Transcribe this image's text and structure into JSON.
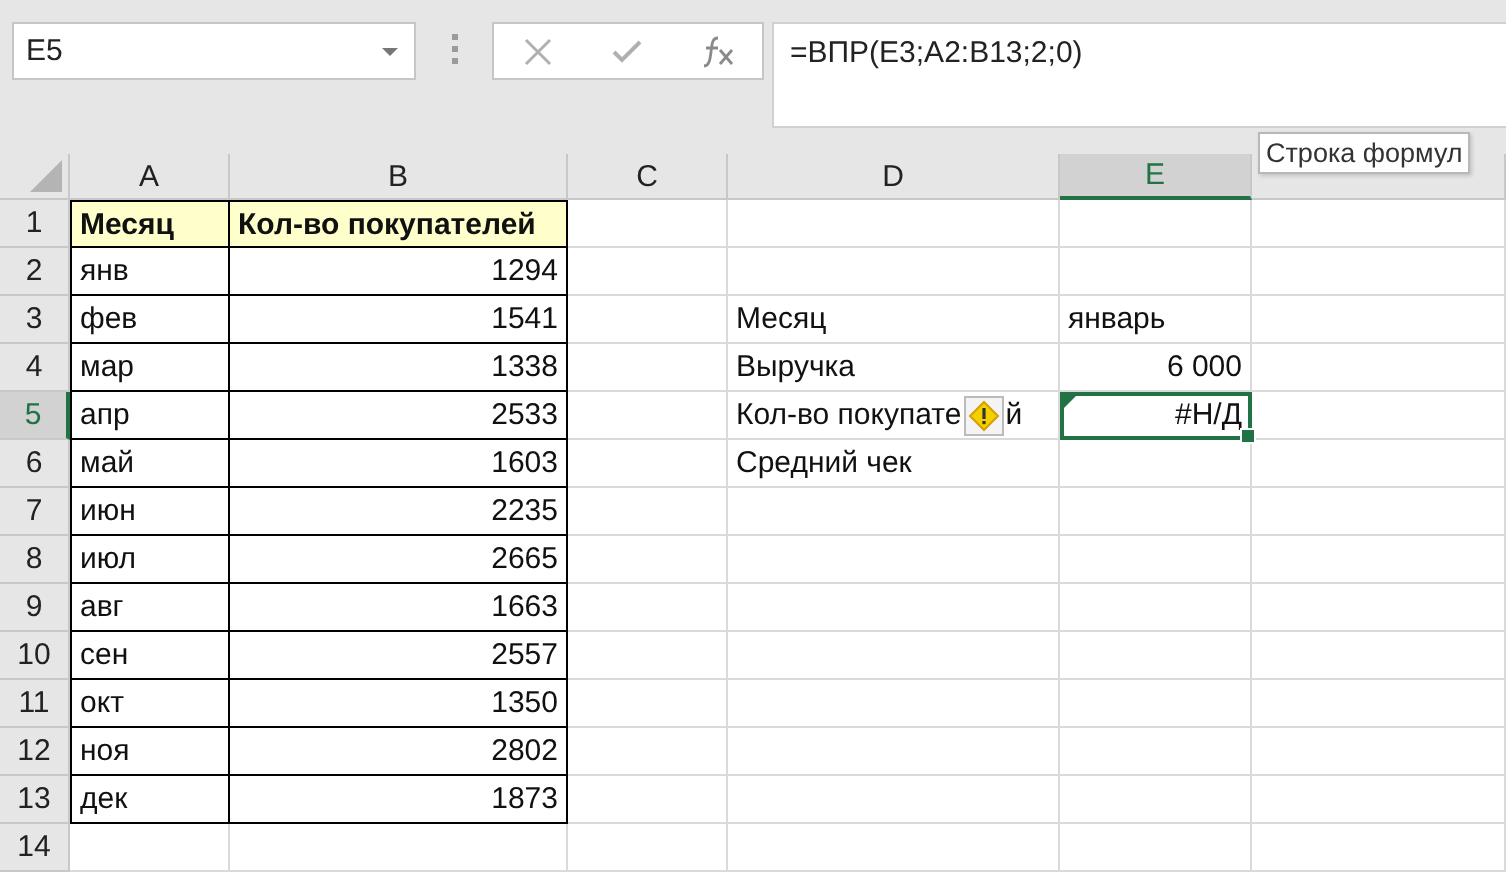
{
  "name_box": {
    "value": "E5"
  },
  "formula_bar": {
    "value": "=ВПР(E3;A2:B13;2;0)",
    "tooltip": "Строка формул"
  },
  "columns": [
    {
      "label": "A",
      "selected": false
    },
    {
      "label": "B",
      "selected": false
    },
    {
      "label": "C",
      "selected": false
    },
    {
      "label": "D",
      "selected": false
    },
    {
      "label": "E",
      "selected": true
    },
    {
      "selected": false
    }
  ],
  "rows": [
    {
      "label": "1",
      "selected": false,
      "cells": [
        {
          "kind": "header",
          "text": "Месяц"
        },
        {
          "kind": "header",
          "text": "Кол-во покупателей"
        },
        null,
        null,
        null,
        null
      ]
    },
    {
      "label": "2",
      "selected": false,
      "cells": [
        {
          "kind": "table_text",
          "text": "янв"
        },
        {
          "kind": "table_number",
          "text": "1294"
        },
        null,
        null,
        null,
        null
      ]
    },
    {
      "label": "3",
      "selected": false,
      "cells": [
        {
          "kind": "table_text",
          "text": "фев"
        },
        {
          "kind": "table_number",
          "text": "1541"
        },
        null,
        {
          "kind": "text",
          "text": "Месяц"
        },
        {
          "kind": "text",
          "text": "январь"
        },
        null
      ]
    },
    {
      "label": "4",
      "selected": false,
      "cells": [
        {
          "kind": "table_text",
          "text": "мар"
        },
        {
          "kind": "table_number",
          "text": "1338"
        },
        null,
        {
          "kind": "text",
          "text": "Выручка"
        },
        {
          "kind": "number",
          "text": "6 000"
        },
        null
      ]
    },
    {
      "label": "5",
      "selected": true,
      "cells": [
        {
          "kind": "table_text",
          "text": "апр"
        },
        {
          "kind": "table_number",
          "text": "2533"
        },
        null,
        {
          "kind": "covered",
          "text_before": "Кол-во покупате",
          "text_after": "й"
        },
        {
          "kind": "error",
          "text": "#Н/Д",
          "active": true
        },
        null
      ]
    },
    {
      "label": "6",
      "selected": false,
      "cells": [
        {
          "kind": "table_text",
          "text": "май"
        },
        {
          "kind": "table_number",
          "text": "1603"
        },
        null,
        {
          "kind": "text",
          "text": "Средний чек"
        },
        null,
        null
      ]
    },
    {
      "label": "7",
      "selected": false,
      "cells": [
        {
          "kind": "table_text",
          "text": "июн"
        },
        {
          "kind": "table_number",
          "text": "2235"
        },
        null,
        null,
        null,
        null
      ]
    },
    {
      "label": "8",
      "selected": false,
      "cells": [
        {
          "kind": "table_text",
          "text": "июл"
        },
        {
          "kind": "table_number",
          "text": "2665"
        },
        null,
        null,
        null,
        null
      ]
    },
    {
      "label": "9",
      "selected": false,
      "cells": [
        {
          "kind": "table_text",
          "text": "авг"
        },
        {
          "kind": "table_number",
          "text": "1663"
        },
        null,
        null,
        null,
        null
      ]
    },
    {
      "label": "10",
      "selected": false,
      "cells": [
        {
          "kind": "table_text",
          "text": "сен"
        },
        {
          "kind": "table_number",
          "text": "2557"
        },
        null,
        null,
        null,
        null
      ]
    },
    {
      "label": "11",
      "selected": false,
      "cells": [
        {
          "kind": "table_text",
          "text": "окт"
        },
        {
          "kind": "table_number",
          "text": "1350"
        },
        null,
        null,
        null,
        null
      ]
    },
    {
      "label": "12",
      "selected": false,
      "cells": [
        {
          "kind": "table_text",
          "text": "ноя"
        },
        {
          "kind": "table_number",
          "text": "2802"
        },
        null,
        null,
        null,
        null
      ]
    },
    {
      "label": "13",
      "selected": false,
      "cells": [
        {
          "kind": "table_text",
          "text": "дек"
        },
        {
          "kind": "table_number",
          "text": "1873"
        },
        null,
        null,
        null,
        null
      ]
    },
    {
      "label": "14",
      "selected": false,
      "cells": [
        null,
        null,
        null,
        null,
        null,
        null
      ]
    }
  ]
}
